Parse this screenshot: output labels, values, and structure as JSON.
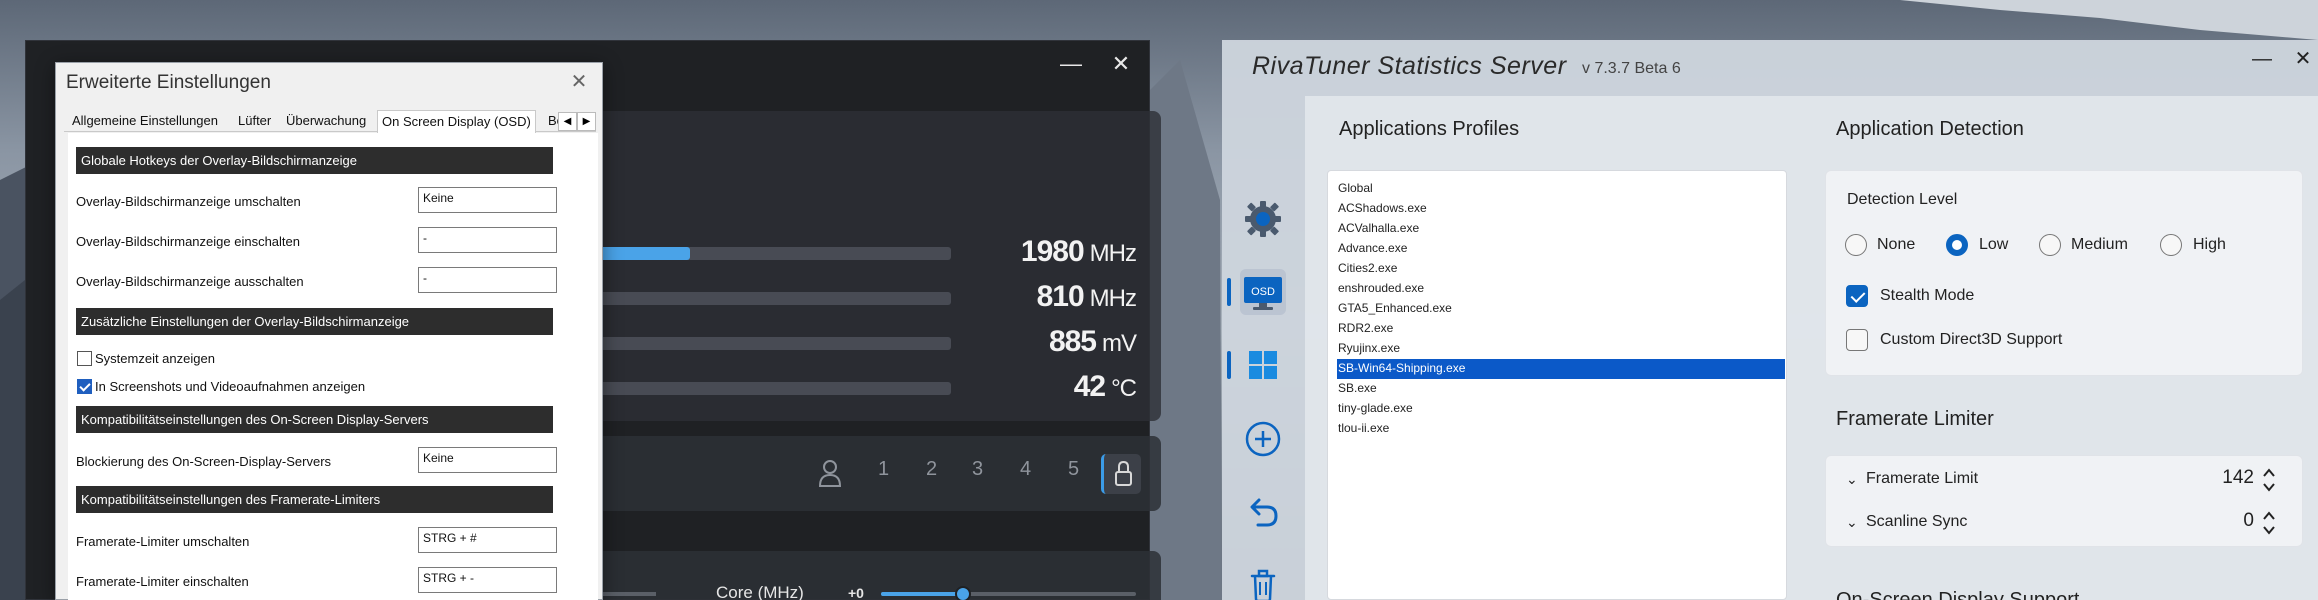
{
  "afterburner": {
    "controls": {
      "minimize": "—",
      "close": "✕"
    },
    "monitors": [
      {
        "value": "1980",
        "unit": "MHz",
        "fill": 0.34
      },
      {
        "value": "810",
        "unit": "MHz",
        "fill": 0.0
      },
      {
        "value": "885",
        "unit": "mV",
        "fill": 0.0
      },
      {
        "value": "42",
        "unit": "°C",
        "fill": 0.0
      }
    ],
    "profiles": [
      "1",
      "2",
      "3",
      "4",
      "5"
    ],
    "core_label": "Core (MHz)",
    "core_offset": "+0"
  },
  "dialog": {
    "title": "Erweiterte Einstellungen",
    "close": "✕",
    "tabs": [
      {
        "label": "Allgemeine Einstellungen"
      },
      {
        "label": "Lüfter"
      },
      {
        "label": "Überwachung"
      },
      {
        "label": "On Screen Display (OSD)"
      },
      {
        "label": "Be"
      }
    ],
    "arrows": {
      "left": "◀",
      "right": "▶"
    },
    "sections": {
      "hotkeys": "Globale Hotkeys der Overlay-Bildschirmanzeige",
      "extra": "Zusätzliche Einstellungen der Overlay-Bildschirmanzeige",
      "compat_osd": "Kompatibilitätseinstellungen des On-Screen Display-Servers",
      "compat_limiter": "Kompatibilitätseinstellungen des Framerate-Limiters"
    },
    "settings": {
      "toggle": {
        "label": "Overlay-Bildschirmanzeige umschalten",
        "value": "Keine"
      },
      "enable": {
        "label": "Overlay-Bildschirmanzeige einschalten",
        "value": "-"
      },
      "disable": {
        "label": "Overlay-Bildschirmanzeige ausschalten",
        "value": "-"
      },
      "systime": {
        "label": "Systemzeit anzeigen",
        "checked": false
      },
      "screens": {
        "label": "In Screenshots und Videoaufnahmen anzeigen",
        "checked": true
      },
      "block": {
        "label": "Blockierung des On-Screen-Display-Servers",
        "value": "Keine"
      },
      "lim_toggle": {
        "label": "Framerate-Limiter umschalten",
        "value": "STRG + #"
      },
      "lim_enable": {
        "label": "Framerate-Limiter einschalten",
        "value": "STRG + -"
      }
    }
  },
  "rtss": {
    "title": "RivaTuner Statistics Server",
    "version": "v 7.3.7 Beta 6",
    "controls": {
      "minimize": "—",
      "close": "✕"
    },
    "nav": {
      "osd_label": "OSD"
    },
    "profiles_title": "Applications Profiles",
    "profiles": [
      "Global",
      "ACShadows.exe",
      "ACValhalla.exe",
      "Advance.exe",
      "Cities2.exe",
      "enshrouded.exe",
      "GTA5_Enhanced.exe",
      "RDR2.exe",
      "Ryujinx.exe",
      "SB-Win64-Shipping.exe",
      "SB.exe",
      "tiny-glade.exe",
      "tlou-ii.exe"
    ],
    "selected_profile": "SB-Win64-Shipping.exe",
    "detection": {
      "title": "Application Detection",
      "level_label": "Detection Level",
      "levels": [
        "None",
        "Low",
        "Medium",
        "High"
      ],
      "selected_level": "Low",
      "stealth_label": "Stealth Mode",
      "stealth_checked": true,
      "d3d_label": "Custom Direct3D Support",
      "d3d_checked": false
    },
    "limiter": {
      "title": "Framerate Limiter",
      "framerate_label": "Framerate Limit",
      "framerate_value": "142",
      "scanline_label": "Scanline Sync",
      "scanline_value": "0"
    },
    "next_section": "On-Screen Display Support"
  },
  "colors": {
    "accent": "#0b64c0",
    "bar": "#4aa3e8",
    "selection": "#0b59c8"
  }
}
